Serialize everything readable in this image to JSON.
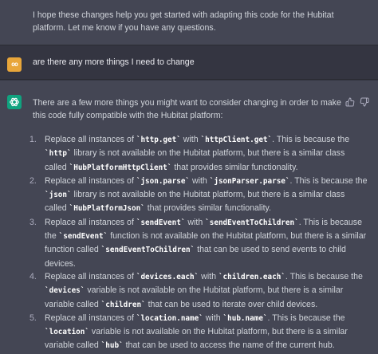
{
  "top_message": {
    "text": "I hope these changes help you get started with adapting this code for the Hubitat platform. Let me know if you have any questions."
  },
  "user_message": {
    "avatar_label": "oo",
    "text": "are there any more things I need to change"
  },
  "assistant_message": {
    "intro": "There are a few more things you might want to consider changing in order to make this code fully compatible with the Hubitat platform:",
    "items": [
      {
        "num": "1.",
        "t1": "Replace all instances of ",
        "c1": "`http.get`",
        "t2": " with ",
        "c2": "`httpClient.get`",
        "t3": ". This is because the ",
        "c3": "`http`",
        "t4": " library is not available on the Hubitat platform, but there is a similar class called ",
        "c4": "`HubPlatformHttpClient`",
        "t5": " that provides similar functionality."
      },
      {
        "num": "2.",
        "t1": "Replace all instances of ",
        "c1": "`json.parse`",
        "t2": " with ",
        "c2": "`jsonParser.parse`",
        "t3": ". This is because the ",
        "c3": "`json`",
        "t4": " library is not available on the Hubitat platform, but there is a similar class called ",
        "c4": "`HubPlatformJson`",
        "t5": " that provides similar functionality."
      },
      {
        "num": "3.",
        "t1": "Replace all instances of ",
        "c1": "`sendEvent`",
        "t2": " with ",
        "c2": "`sendEventToChildren`",
        "t3": ". This is because the ",
        "c3": "`sendEvent`",
        "t4": " function is not available on the Hubitat platform, but there is a similar function called ",
        "c4": "`sendEventToChildren`",
        "t5": " that can be used to send events to child devices."
      },
      {
        "num": "4.",
        "t1": "Replace all instances of ",
        "c1": "`devices.each`",
        "t2": " with ",
        "c2": "`children.each`",
        "t3": ". This is because the ",
        "c3": "`devices`",
        "t4": " variable is not available on the Hubitat platform, but there is a similar variable called ",
        "c4": "`children`",
        "t5": " that can be used to iterate over child devices."
      },
      {
        "num": "5.",
        "t1": "Replace all instances of ",
        "c1": "`location.name`",
        "t2": " with ",
        "c2": "`hub.name`",
        "t3": ". This is because the ",
        "c3": "`location`",
        "t4": " variable is not available on the Hubitat platform, but there is a similar variable called ",
        "c4": "`hub`",
        "t5": " that can be used to access the name of the current hub."
      }
    ]
  },
  "icons": {
    "thumbs_up": "thumbs-up-icon",
    "thumbs_down": "thumbs-down-icon",
    "assistant_logo": "openai-logo-icon"
  },
  "colors": {
    "background_dark": "#343541",
    "background_light": "#444654",
    "user_avatar": "#e8a63a",
    "assistant_avatar": "#10a37f"
  }
}
